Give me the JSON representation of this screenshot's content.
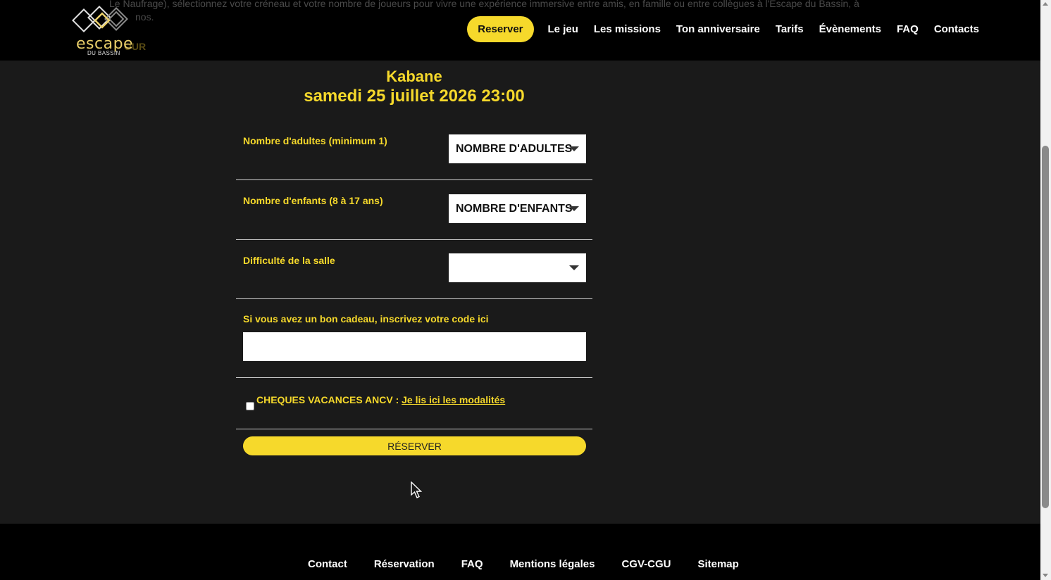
{
  "header": {
    "background_text_line1": "Le Naufrage), sélectionnez votre créneau et votre nombre de joueurs pour vivre une expérience immersive entre amis, en famille ou entre collègues à l'Escape du Bassin, à",
    "background_text_line2": "nos.",
    "background_retour": "OUR",
    "logo_word": "escape",
    "logo_sub": "DU BASSIN",
    "nav": {
      "reserve": "Reserver",
      "items": [
        "Le jeu",
        "Les missions",
        "Ton anniversaire",
        "Tarifs",
        "Évènements",
        "FAQ",
        "Contacts"
      ]
    }
  },
  "booking": {
    "room": "Kabane",
    "datetime": "samedi 25 juillet 2026 23:00",
    "adults_label": "Nombre d'adultes (minimum 1)",
    "adults_value": "NOMBRE D'ADULTES",
    "children_label": "Nombre d'enfants (8 à 17 ans)",
    "children_value": "NOMBRE D'ENFANTS",
    "difficulty_label": "Difficulté de la salle",
    "difficulty_value": "",
    "gift_label": "Si vous avez un bon cadeau, inscrivez votre code ici",
    "gift_value": "",
    "ancv_label": "CHEQUES VACANCES ANCV : ",
    "ancv_link": "Je lis ici les modalités",
    "ancv_checked": false,
    "submit": "RÉSERVER"
  },
  "footer": {
    "links": [
      "Contact",
      "Réservation",
      "FAQ",
      "Mentions légales",
      "CGV-CGU",
      "Sitemap"
    ]
  },
  "colors": {
    "accent": "#f6d92b",
    "background": "#1a1a1a",
    "header_bg": "#000000"
  }
}
